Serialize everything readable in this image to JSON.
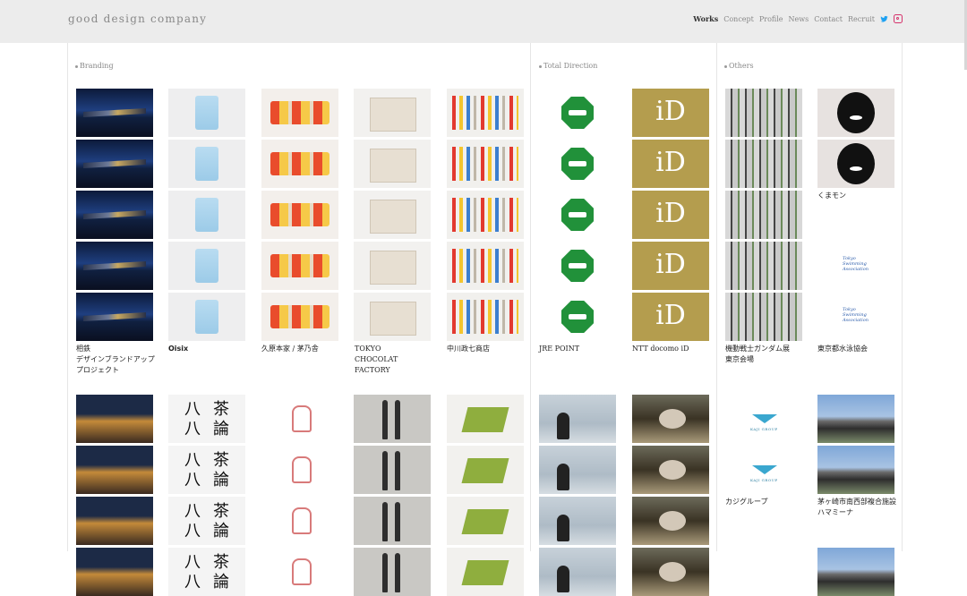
{
  "header": {
    "logo": "good design company",
    "nav": [
      "Works",
      "Concept",
      "Profile",
      "News",
      "Contact",
      "Recruit"
    ],
    "active": "Works",
    "icons": [
      "twitter-icon",
      "instagram-icon"
    ],
    "colors": {
      "twitter": "#1da1f2",
      "instagram": "#d6336c"
    }
  },
  "sections": {
    "branding": "Branding",
    "total": "Total Direction",
    "others": "Others"
  },
  "captions": {
    "sotetsu": "相鉄\nデザインブランドアップ\nプロジェクト",
    "oisix": "Oisix",
    "kuzu": "久原本家 / 茅乃舎",
    "tcf": "TOKYO CHOCOLAT FACTORY",
    "nakagawa": "中川政七商店",
    "jre": "JRE POINT",
    "id": "NTT docomo iD",
    "gundam": "機動戦士ガンダム展\n東京会場",
    "kumamon": "くまモン",
    "tsa": "東京都水泳協会",
    "kaji": "カジグループ",
    "chigasaki": "茅ヶ崎市南西部複合施設\nハマミーナ"
  },
  "thumb_text": {
    "id": "iD",
    "tsa": "Tokyo\nSwimming\nAssociation",
    "kaji": "KAJI GROUP",
    "cha": "八茶\n八論"
  }
}
